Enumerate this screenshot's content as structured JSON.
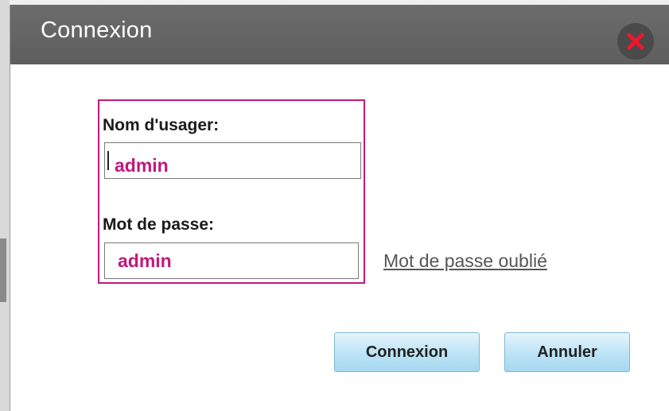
{
  "dialog": {
    "title": "Connexion",
    "close_icon": "close-icon"
  },
  "form": {
    "username_label": "Nom d'usager:",
    "username_value": "admin",
    "password_label": "Mot de passe:",
    "password_value": "admin",
    "forgot_password_link": "Mot de passe oublié"
  },
  "buttons": {
    "login_label": "Connexion",
    "cancel_label": "Annuler"
  },
  "colors": {
    "titlebar": "#5e5e5e",
    "highlight": "#c2187b",
    "close_x": "#e8192c",
    "button": "#bfe4f6"
  }
}
